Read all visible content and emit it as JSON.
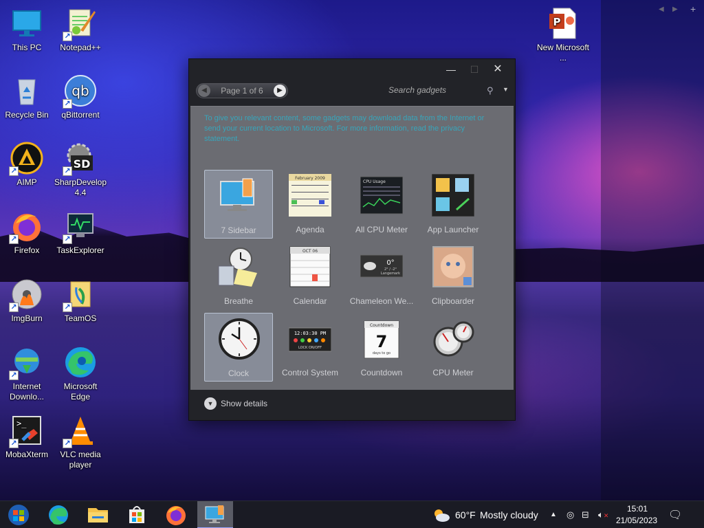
{
  "desktop": {
    "icons": [
      {
        "label": "This PC"
      },
      {
        "label": "Notepad++"
      },
      {
        "label": "Recycle Bin"
      },
      {
        "label": "qBittorrent"
      },
      {
        "label": "AIMP"
      },
      {
        "label": "SharpDevelop 4.4"
      },
      {
        "label": "Firefox"
      },
      {
        "label": "TaskExplorer"
      },
      {
        "label": "ImgBurn"
      },
      {
        "label": "TeamOS"
      },
      {
        "label": "Internet Downlo..."
      },
      {
        "label": "Microsoft Edge"
      },
      {
        "label": "MobaXterm"
      },
      {
        "label": "VLC media player"
      },
      {
        "label": "New Microsoft ..."
      }
    ]
  },
  "gadgets_window": {
    "pager_label": "Page 1 of 6",
    "search_placeholder": "Search gadgets",
    "notice": "To give you relevant content, some gadgets may download data from the Internet or send your current location to Microsoft. For more information, read the privacy statement.",
    "items": [
      {
        "label": "7 Sidebar",
        "selected": true
      },
      {
        "label": "Agenda"
      },
      {
        "label": "All CPU Meter"
      },
      {
        "label": "App Launcher"
      },
      {
        "label": "Breathe"
      },
      {
        "label": "Calendar"
      },
      {
        "label": "Chameleon We..."
      },
      {
        "label": "Clipboarder"
      },
      {
        "label": "Clock",
        "selected": true
      },
      {
        "label": "Control System"
      },
      {
        "label": "Countdown"
      },
      {
        "label": "CPU Meter"
      }
    ],
    "details_label": "Show details",
    "thumb_text": {
      "agenda_month": "February 2009",
      "countdown_title": "Countdown",
      "countdown_num": "7",
      "countdown_sub": "days to go",
      "control_time": "12:03:30 PM",
      "control_lock": "LOCK ON/OFF",
      "chameleon_temp": "0°",
      "chameleon_range": "2° / -2°",
      "chameleon_city": "Langemark",
      "calendar_month": "OCT 06",
      "cpu_title": "CPU Usage"
    }
  },
  "taskbar": {
    "weather_temp": "60°F",
    "weather_text": "Mostly cloudy",
    "time": "15:01",
    "date": "21/05/2023"
  },
  "colors": {
    "window_bg": "#222328",
    "panel_bg": "#6b6c72",
    "notice": "#2fb0c8",
    "taskbar": "#1a1b24"
  }
}
